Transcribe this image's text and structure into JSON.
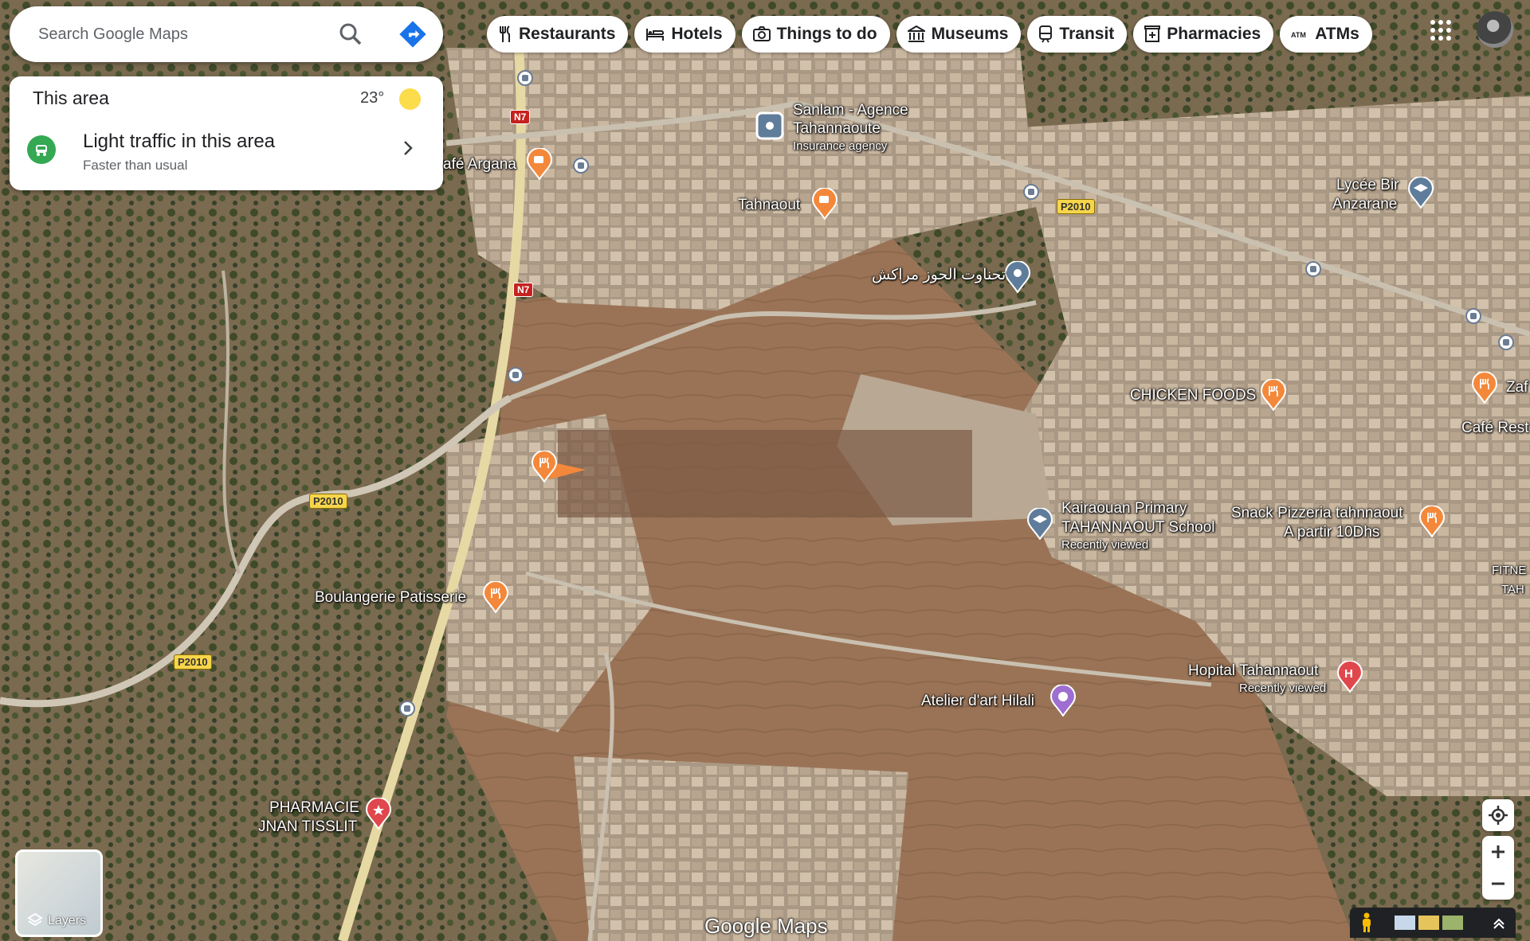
{
  "search": {
    "placeholder": "Search Google Maps"
  },
  "chips": [
    {
      "label": "Restaurants",
      "icon": "fork-knife-icon"
    },
    {
      "label": "Hotels",
      "icon": "bed-icon"
    },
    {
      "label": "Things to do",
      "icon": "camera-icon"
    },
    {
      "label": "Museums",
      "icon": "museum-icon"
    },
    {
      "label": "Transit",
      "icon": "train-icon"
    },
    {
      "label": "Pharmacies",
      "icon": "pharmacy-icon"
    },
    {
      "label": "ATMs",
      "icon": "atm-icon"
    }
  ],
  "info": {
    "area_title": "This area",
    "temperature": "23°",
    "traffic_title": "Light traffic in this area",
    "traffic_subtitle": "Faster than usual"
  },
  "places": {
    "sanlam_name_1": "Sanlam - Agence",
    "sanlam_name_2": "Tahannaoute",
    "sanlam_type": "Insurance agency",
    "cafe_argana": "afé Argana",
    "tahnaout": "Tahnaout",
    "arabic_label": "تحناوت الحوز مراكش",
    "lycee_1": "Lycée Bir",
    "lycee_2": "Anzarane",
    "chicken_foods": "CHICKEN FOODS",
    "zaf": "Zaf",
    "cafe_rest": "Café Rest",
    "kairaouan_1": "Kairaouan Primary",
    "kairaouan_2": "TAHANNAOUT School",
    "kairaouan_note": "Recently viewed",
    "snack_1": "Snack Pizzeria tahnnaout",
    "snack_2": "A partir 10Dhs",
    "fitne_1": "FITNE",
    "fitne_2": "TAH",
    "boulangerie": "Boulangerie Patisserie",
    "hopital": "Hopital Tahannaout",
    "hopital_note": "Recently viewed",
    "atelier": "Atelier d'art Hilali",
    "pharmacie_1": "PHARMACIE",
    "pharmacie_2": "JNAN TISSLIT"
  },
  "roads": {
    "n7": "N7",
    "p2010": "P2010"
  },
  "controls": {
    "layers_label": "Layers",
    "logo": "Google Maps"
  },
  "colors": {
    "accent": "#1a73e8",
    "restaurant_pin": "#f4883a",
    "hospital_pin": "#e0474c",
    "school_pin": "#5f7d9a",
    "art_pin": "#9e6ed0",
    "traffic_green": "#34a853"
  }
}
